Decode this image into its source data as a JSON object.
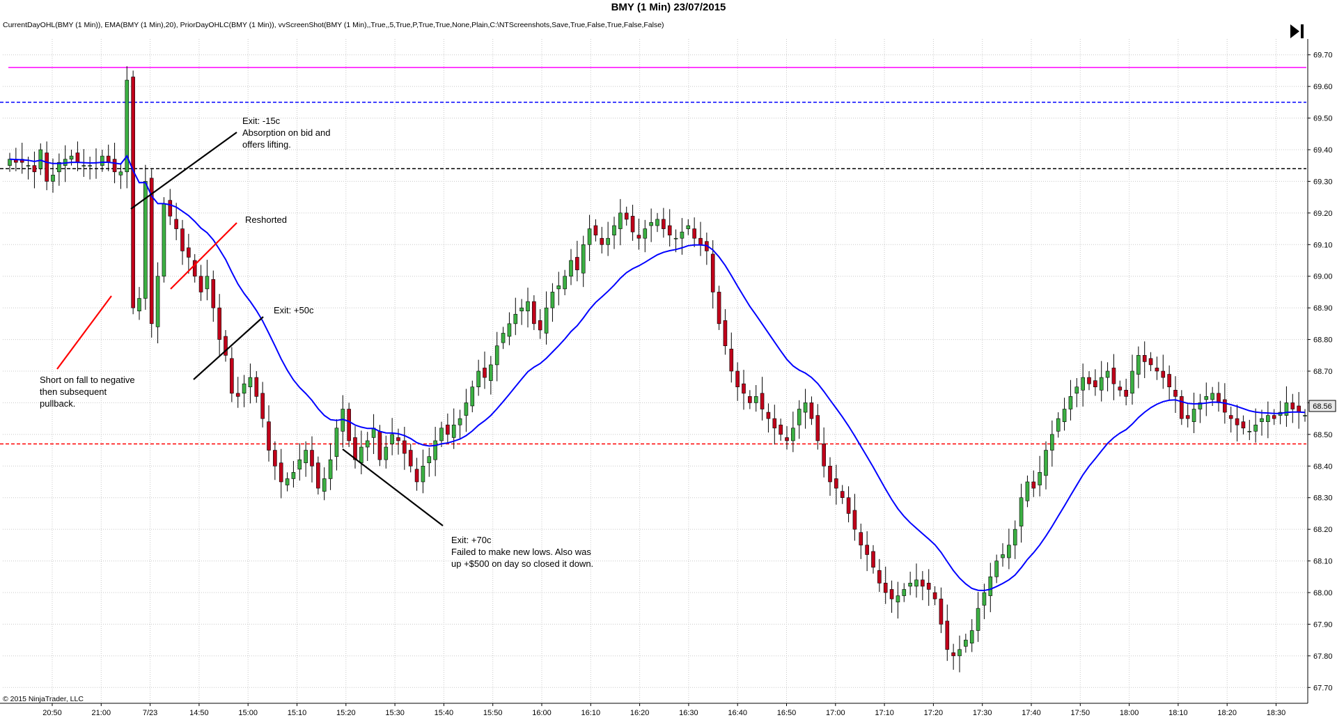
{
  "title": "BMY (1 Min)  23/07/2015",
  "indicators": "CurrentDayOHL(BMY (1 Min)), EMA(BMY (1 Min),20), PriorDayOHLC(BMY (1 Min)), vvScreenShot(BMY (1 Min),,True,,5,True,P,True,True,None,Plain,C:\\NTScreenshots,Save,True,False,True,False,False)",
  "copyright": "© 2015 NinjaTrader, LLC",
  "last_price_label": "68.56",
  "colors": {
    "up_candle": "#3cb043",
    "down_candle": "#c0001a",
    "ema": "#0000ff",
    "current_day_high": "#ff00ff",
    "prior_high": "#0000ff",
    "prior_close": "#000000",
    "prior_low": "#ff0000"
  },
  "chart_data": {
    "type": "candlestick",
    "title": "BMY (1 Min)  23/07/2015",
    "ylim": [
      67.65,
      69.75
    ],
    "y_ticks": [
      "69.70",
      "69.60",
      "69.50",
      "69.40",
      "69.30",
      "69.20",
      "69.10",
      "69.00",
      "68.90",
      "68.80",
      "68.70",
      "68.60",
      "68.50",
      "68.40",
      "68.30",
      "68.20",
      "68.10",
      "68.00",
      "67.90",
      "67.80",
      "67.70"
    ],
    "x_tick_labels": [
      "20:50",
      "21:00",
      "7/23",
      "14:50",
      "15:00",
      "15:10",
      "15:20",
      "15:30",
      "15:40",
      "15:50",
      "16:00",
      "16:10",
      "16:20",
      "16:30",
      "16:40",
      "16:50",
      "17:00",
      "17:10",
      "17:20",
      "17:30",
      "17:40",
      "17:50",
      "18:00",
      "18:10",
      "18:20",
      "18:30"
    ],
    "grid": true,
    "horizontal_levels": [
      {
        "name": "Current day high",
        "value": 69.66,
        "style": "solid",
        "color": "#ff00ff"
      },
      {
        "name": "Prior day high",
        "value": 69.55,
        "style": "dashed",
        "color": "#0000ff"
      },
      {
        "name": "Prior day close",
        "value": 69.34,
        "style": "dashed",
        "color": "#000000"
      },
      {
        "name": "Prior day low",
        "value": 68.47,
        "style": "dashed",
        "color": "#ff0000"
      }
    ],
    "close_path": [
      69.37,
      69.36,
      69.36,
      69.35,
      69.33,
      69.4,
      69.3,
      69.32,
      69.36,
      69.37,
      69.38,
      69.36,
      69.35,
      69.35,
      69.36,
      69.38,
      69.36,
      69.33,
      69.33,
      69.62,
      68.9,
      68.93,
      69.3,
      68.85,
      69.0,
      69.23,
      69.19,
      69.15,
      69.08,
      69.06,
      69.0,
      68.95,
      69.0,
      68.9,
      68.8,
      68.75,
      68.63,
      68.62,
      68.66,
      68.68,
      68.62,
      68.55,
      68.45,
      68.4,
      68.35,
      68.36,
      68.38,
      68.42,
      68.45,
      68.4,
      68.33,
      68.36,
      68.42,
      68.52,
      68.58,
      68.48,
      68.42,
      68.46,
      68.48,
      68.52,
      68.42,
      68.46,
      68.5,
      68.48,
      68.44,
      68.4,
      68.35,
      68.4,
      68.43,
      68.48,
      68.52,
      68.5,
      68.53,
      68.55,
      68.6,
      68.65,
      68.7,
      68.68,
      68.72,
      68.78,
      68.82,
      68.85,
      68.88,
      68.9,
      68.92,
      68.85,
      68.83,
      68.9,
      68.95,
      68.97,
      69.0,
      69.05,
      69.02,
      69.1,
      69.15,
      69.13,
      69.1,
      69.12,
      69.16,
      69.2,
      69.18,
      69.14,
      69.12,
      69.15,
      69.17,
      69.18,
      69.15,
      69.13,
      69.12,
      69.14,
      69.16,
      69.12,
      69.1,
      69.08,
      68.95,
      68.85,
      68.78,
      68.7,
      68.65,
      68.63,
      68.6,
      68.62,
      68.58,
      68.55,
      68.52,
      68.5,
      68.48,
      68.52,
      68.58,
      68.6,
      68.55,
      68.48,
      68.4,
      68.35,
      68.33,
      68.3,
      68.25,
      68.2,
      68.15,
      68.12,
      68.08,
      68.03,
      68.0,
      67.98,
      67.99,
      68.01,
      68.03,
      68.04,
      68.02,
      68.01,
      67.98,
      67.9,
      67.82,
      67.8,
      67.82,
      67.85,
      67.88,
      67.95,
      68.0,
      68.05,
      68.1,
      68.12,
      68.15,
      68.2,
      68.3,
      68.35,
      68.33,
      68.38,
      68.45,
      68.5,
      68.55,
      68.58,
      68.62,
      68.65,
      68.68,
      68.66,
      68.65,
      68.68,
      68.7,
      68.66,
      68.64,
      68.62,
      68.7,
      68.75,
      68.73,
      68.72,
      68.7,
      68.68,
      68.65,
      68.62,
      68.55,
      68.55,
      68.58,
      68.6,
      68.62,
      68.63,
      68.6,
      68.57,
      68.55,
      68.53,
      68.52,
      68.51,
      68.53,
      68.55,
      68.56,
      68.55,
      68.57,
      68.6,
      68.58,
      68.57,
      68.56
    ]
  },
  "annotations": [
    {
      "lines": [
        "Exit: -15c",
        "Absorption on bid and",
        "offers lifting."
      ],
      "color": "#000000"
    },
    {
      "lines": [
        "Reshorted"
      ],
      "color": "#ff0000"
    },
    {
      "lines": [
        "Exit: +50c"
      ],
      "color": "#000000"
    },
    {
      "lines": [
        "Short on fall to negative",
        "then subsequent",
        "pullback."
      ],
      "color": "#ff0000"
    },
    {
      "lines": [
        "Exit: +70c",
        "Failed to make new lows. Also was",
        "up +$500 on day so closed it down."
      ],
      "color": "#000000"
    }
  ]
}
